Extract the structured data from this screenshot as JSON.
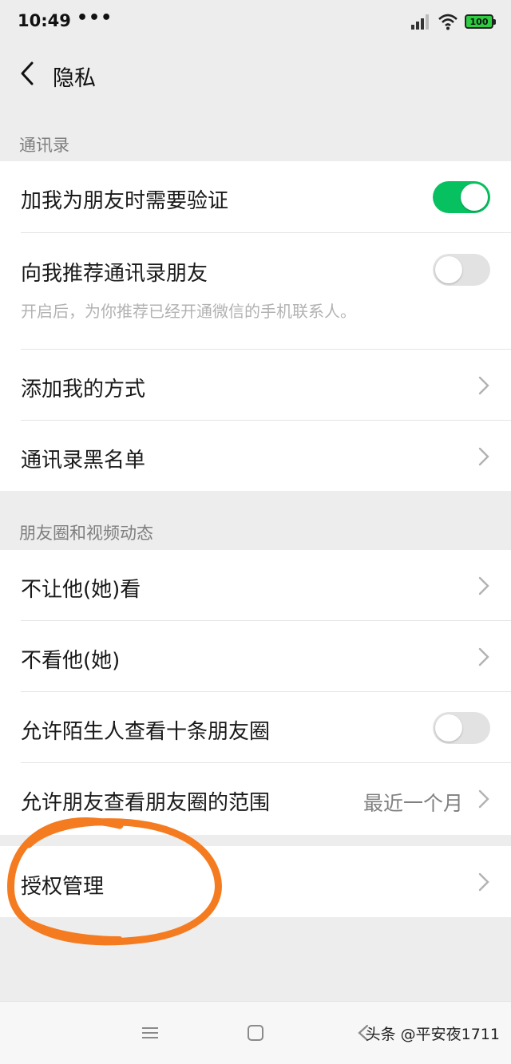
{
  "status_bar": {
    "time": "10:49",
    "dots": "•••",
    "battery": "100",
    "signal_icon": "signal-icon",
    "wifi_icon": "wifi-icon",
    "battery_color": "#2ecc40"
  },
  "nav": {
    "title": "隐私",
    "back_icon": "back-arrow-icon"
  },
  "sections": {
    "contacts_label": "通讯录",
    "moments_label": "朋友圈和视频动态"
  },
  "rows": {
    "verify": {
      "label": "加我为朋友时需要验证",
      "toggle": true
    },
    "recommend": {
      "label": "向我推荐通讯录朋友",
      "sub": "开启后，为你推荐已经开通微信的手机联系人。",
      "toggle": false
    },
    "add_methods": {
      "label": "添加我的方式"
    },
    "blacklist": {
      "label": "通讯录黑名单"
    },
    "hide_from": {
      "label": "不让他(她)看"
    },
    "dont_see": {
      "label": "不看他(她)"
    },
    "stranger_ten": {
      "label": "允许陌生人查看十条朋友圈",
      "toggle": false
    },
    "range": {
      "label": "允许朋友查看朋友圈的范围",
      "value": "最近一个月"
    },
    "authorization": {
      "label": "授权管理"
    }
  },
  "colors": {
    "accent": "#07c160",
    "background": "#ededed",
    "annotation": "#f47b20"
  },
  "system_nav": {
    "menu_icon": "menu-icon",
    "home_icon": "home-square-icon",
    "back_icon": "back-triangle-icon"
  },
  "watermark": "头条 @平安夜1711"
}
